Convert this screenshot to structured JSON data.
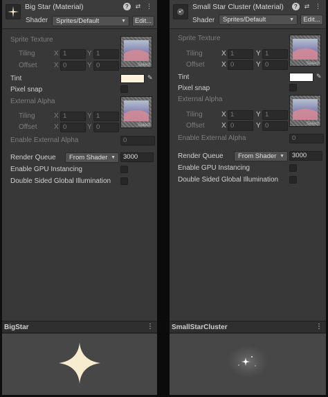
{
  "left": {
    "title": "Big Star (Material)",
    "shader_label": "Shader",
    "shader_value": "Sprites/Default",
    "edit_label": "Edit...",
    "sprite_texture_label": "Sprite Texture",
    "tiling_label": "Tiling",
    "offset_label": "Offset",
    "tiling_x": "1",
    "tiling_y": "1",
    "offset_x": "0",
    "offset_y": "0",
    "select_label": "Select",
    "tint_label": "Tint",
    "tint_color": "#fff3dc",
    "pixel_snap_label": "Pixel snap",
    "external_alpha_label": "External Alpha",
    "ext_tiling_x": "1",
    "ext_tiling_y": "1",
    "ext_offset_x": "0",
    "ext_offset_y": "0",
    "enable_external_alpha_label": "Enable External Alpha",
    "enable_external_alpha_value": "0",
    "render_queue_label": "Render Queue",
    "render_queue_mode": "From Shader",
    "render_queue_value": "3000",
    "gpu_instancing_label": "Enable GPU Instancing",
    "double_sided_gi_label": "Double Sided Global Illumination",
    "preview_name": "BigStar"
  },
  "right": {
    "title": "Small Star Cluster (Material)",
    "shader_label": "Shader",
    "shader_value": "Sprites/Default",
    "edit_label": "Edit...",
    "sprite_texture_label": "Sprite Texture",
    "tiling_label": "Tiling",
    "offset_label": "Offset",
    "tiling_x": "1",
    "tiling_y": "1",
    "offset_x": "0",
    "offset_y": "0",
    "select_label": "Select",
    "tint_label": "Tint",
    "tint_color": "#ffffff",
    "pixel_snap_label": "Pixel snap",
    "external_alpha_label": "External Alpha",
    "ext_tiling_x": "1",
    "ext_tiling_y": "1",
    "ext_offset_x": "0",
    "ext_offset_y": "0",
    "enable_external_alpha_label": "Enable External Alpha",
    "enable_external_alpha_value": "0",
    "render_queue_label": "Render Queue",
    "render_queue_mode": "From Shader",
    "render_queue_value": "3000",
    "gpu_instancing_label": "Enable GPU Instancing",
    "double_sided_gi_label": "Double Sided Global Illumination",
    "preview_name": "SmallStarCluster"
  },
  "axis": {
    "x": "X",
    "y": "Y"
  },
  "icons": {
    "help": "help-icon",
    "settings": "preset-settings-icon",
    "menu": "kebab-menu-icon",
    "dropper": "eyedropper-icon"
  }
}
